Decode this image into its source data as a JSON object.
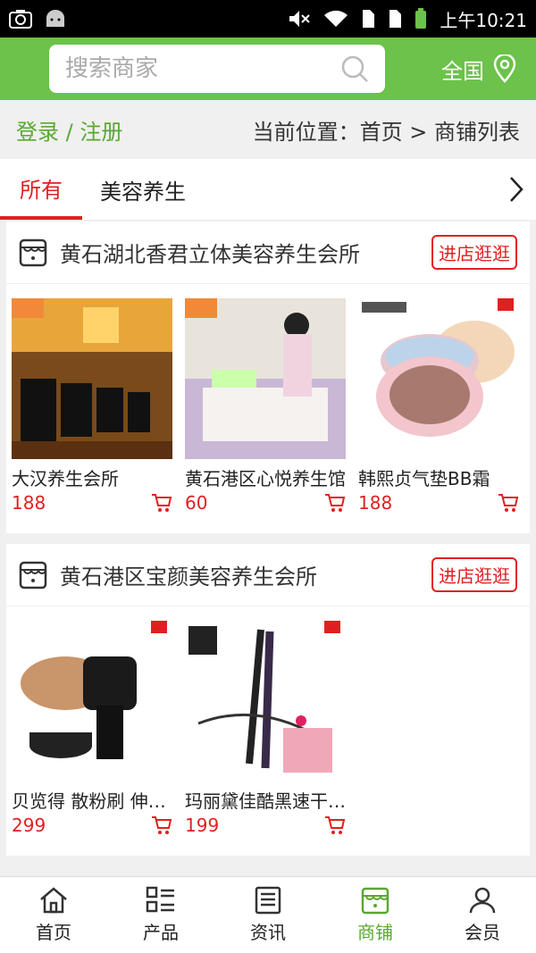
{
  "status": {
    "time": "上午10:21"
  },
  "search": {
    "placeholder": "搜索商家"
  },
  "region": {
    "label": "全国"
  },
  "crumbbar": {
    "login": "登录 / 注册",
    "location": "当前位置：首页 > 商铺列表"
  },
  "tabs": [
    {
      "label": "所有"
    },
    {
      "label": "美容养生"
    }
  ],
  "shops": [
    {
      "name": "黄石湖北香君立体美容养生会所",
      "enter": "进店逛逛",
      "products": [
        {
          "name": "大汉养生会所",
          "price": "188"
        },
        {
          "name": "黄石港区心悦养生馆",
          "price": "60"
        },
        {
          "name": "韩熙贞气垫BB霜",
          "price": "188"
        }
      ]
    },
    {
      "name": "黄石港区宝颜美容养生会所",
      "enter": "进店逛逛",
      "products": [
        {
          "name": "贝览得 散粉刷 伸缩刷",
          "price": "299"
        },
        {
          "name": "玛丽黛佳酷黑速干眼线液",
          "price": "199"
        }
      ]
    }
  ],
  "nav": [
    {
      "label": "首页",
      "icon": "home-icon"
    },
    {
      "label": "产品",
      "icon": "grid-list-icon"
    },
    {
      "label": "资讯",
      "icon": "news-icon"
    },
    {
      "label": "商铺",
      "icon": "store-icon"
    },
    {
      "label": "会员",
      "icon": "user-icon"
    }
  ],
  "colors": {
    "green": "#6cc24a",
    "red": "#e02020"
  }
}
